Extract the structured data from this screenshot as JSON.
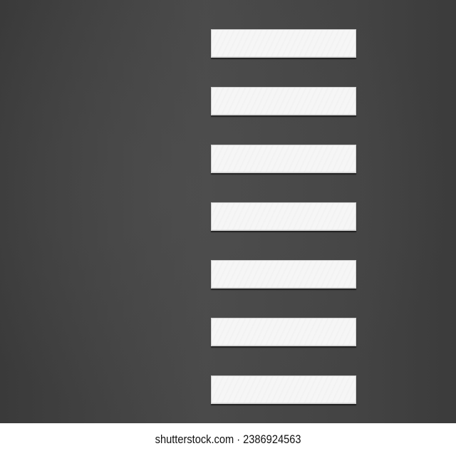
{
  "canvas": {
    "background": "#444444",
    "bar_color": "#f6f6f6",
    "bar_count": 7
  },
  "watermark": {
    "text": "shutterstock.com · 2386924563"
  }
}
